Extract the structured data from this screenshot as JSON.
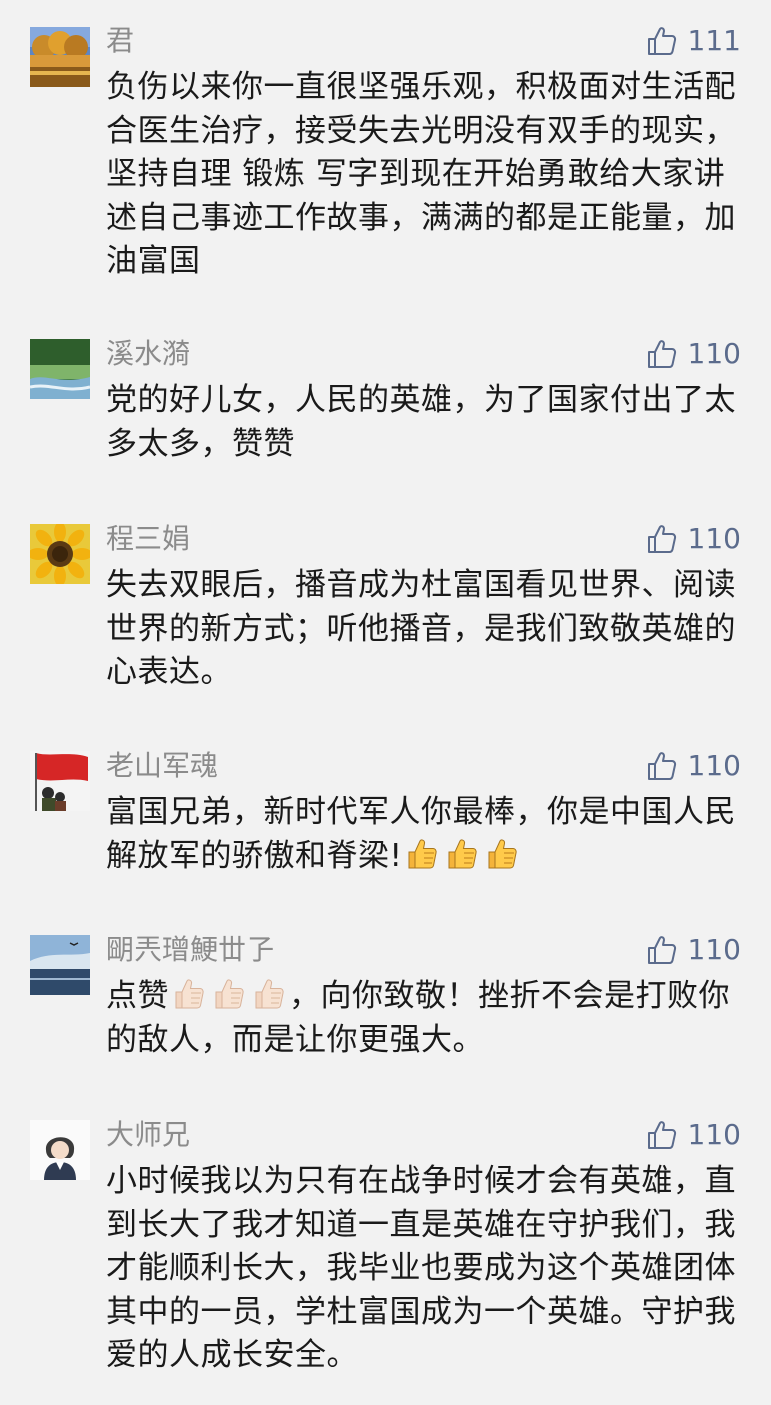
{
  "comments": [
    {
      "name": "君",
      "likes": "111",
      "text": "负伤以来你一直很坚强乐观，积极面对生活配合医生治疗，接受失去光明没有双手的现实，坚持自理 锻炼 写字到现在开始勇敢给大家讲述自己事迹工作故事，满满的都是正能量，加油富国"
    },
    {
      "name": "溪水漪",
      "likes": "110",
      "text": "党的好儿女，人民的英雄，为了国家付出了太多太多，赞赞"
    },
    {
      "name": "程三娟",
      "likes": "110",
      "text": "失去双眼后，播音成为杜富国看见世界、阅读世界的新方式；听他播音，是我们致敬英雄的心表达。"
    },
    {
      "name": "老山军魂",
      "likes": "110",
      "text": "富国兄弟，新时代军人你最棒，你是中国人民解放军的骄傲和脊梁!"
    },
    {
      "name": "朙兲璔鯁丗孒",
      "likes": "110",
      "text_before": "点赞",
      "text": "，向你致敬！挫折不会是打败你的敌人，而是让你更强大。"
    },
    {
      "name": "大师兄",
      "likes": "110",
      "text": "小时候我以为只有在战争时候才会有英雄，直到长大了我才知道一直是英雄在守护我们，我才能顺利长大，我毕业也要成为这个英雄团体其中的一员，学杜富国成为一个英雄。守护我爱的人成长安全。"
    }
  ],
  "icons": {
    "like": "thumbs-up-outline-icon",
    "emoji_thumb": "thumbs-up-emoji"
  },
  "colors": {
    "background": "#f2f2f2",
    "name": "#8b8b8b",
    "likes": "#5b6b8c",
    "text": "#1a1a1a"
  }
}
